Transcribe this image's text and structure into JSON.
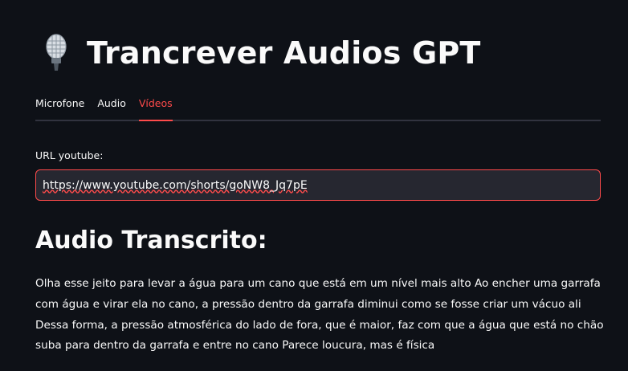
{
  "header": {
    "title": "Trancrever Audios GPT",
    "icon": "microphone-icon"
  },
  "tabs": [
    {
      "label": "Microfone",
      "active": false
    },
    {
      "label": "Audio",
      "active": false
    },
    {
      "label": "Vídeos",
      "active": true
    }
  ],
  "url_field": {
    "label": "URL youtube:",
    "value": "https://www.youtube.com/shorts/goNW8_Jq7pE"
  },
  "result": {
    "heading": "Audio Transcrito:",
    "text": "Olha esse jeito para levar a água para um cano que está em um nível mais alto Ao encher uma garrafa com água e virar ela no cano, a pressão dentro da garrafa diminui como se fosse criar um vácuo ali Dessa forma, a pressão atmosférica do lado de fora, que é maior, faz com que a água que está no chão suba para dentro da garrafa e entre no cano Parece loucura, mas é física"
  },
  "colors": {
    "background": "#0e1117",
    "accent": "#ff4b4b",
    "input_bg": "#262730",
    "divider": "#31333f",
    "text": "#fafafa"
  }
}
